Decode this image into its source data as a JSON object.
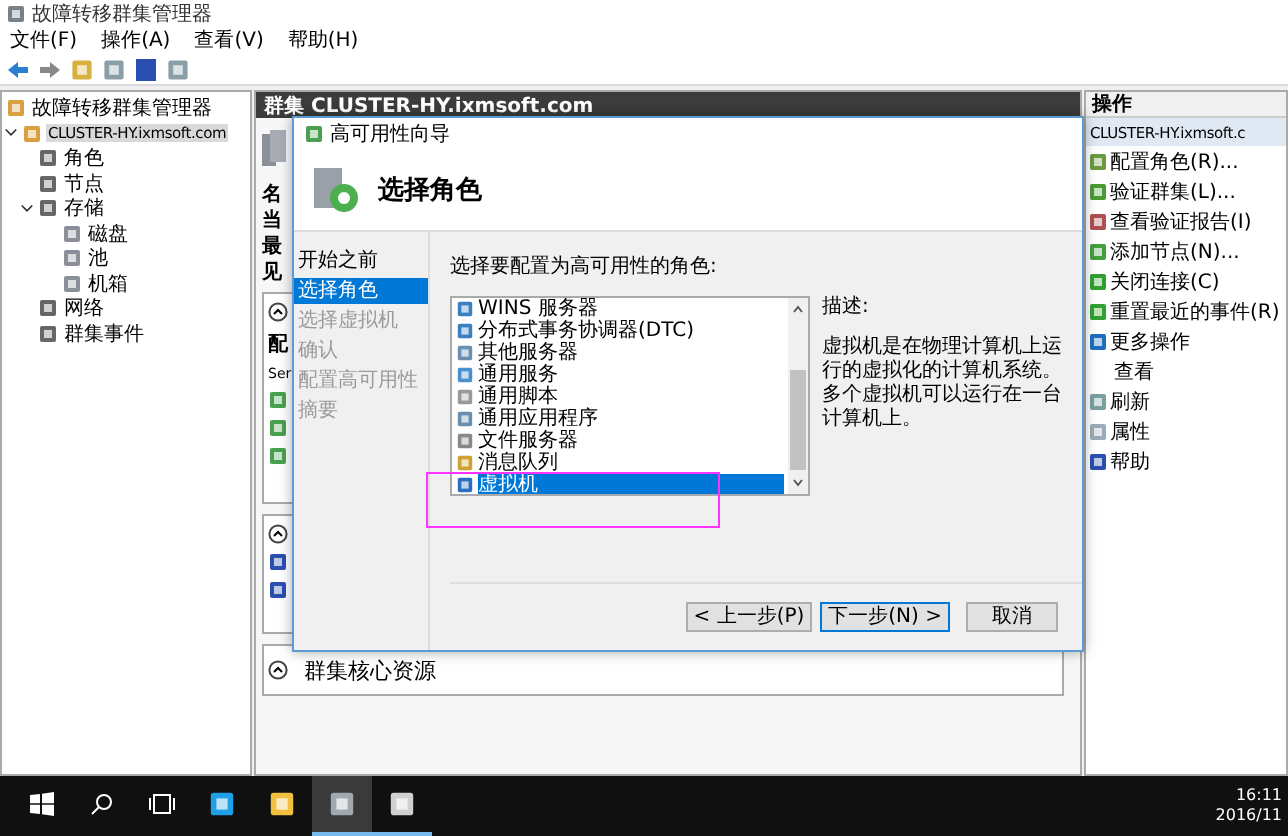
{
  "window": {
    "title": "故障转移群集管理器"
  },
  "menu": [
    "文件(F)",
    "操作(A)",
    "查看(V)",
    "帮助(H)"
  ],
  "tree": [
    {
      "label": "故障转移群集管理器",
      "selected": false,
      "children": [
        {
          "label": "CLUSTER-HY.ixmsoft.com",
          "selected": true,
          "expanded": true,
          "children": [
            {
              "label": "角色",
              "selected": false
            },
            {
              "label": "节点",
              "selected": false
            },
            {
              "label": "存储",
              "selected": false,
              "expanded": true,
              "children": [
                {
                  "label": "磁盘",
                  "selected": false
                },
                {
                  "label": "池",
                  "selected": false
                },
                {
                  "label": "机箱",
                  "selected": false
                }
              ]
            },
            {
              "label": "网络",
              "selected": false
            },
            {
              "label": "群集事件",
              "selected": false
            }
          ]
        }
      ]
    }
  ],
  "center": {
    "header": "群集 CLUSTER-HY.ixmsoft.com",
    "labels_cut": [
      "名",
      "当",
      "最",
      "见"
    ],
    "summary_cut": [
      "配",
      "Ser"
    ],
    "section": "群集核心资源"
  },
  "dialog": {
    "title": "高可用性向导",
    "heading": "选择角色",
    "steps": [
      {
        "label": "开始之前",
        "selected": false,
        "disabled": false
      },
      {
        "label": "选择角色",
        "selected": true,
        "disabled": false
      },
      {
        "label": "选择虚拟机",
        "selected": false,
        "disabled": true
      },
      {
        "label": "确认",
        "selected": false,
        "disabled": true
      },
      {
        "label": "配置高可用性",
        "selected": false,
        "disabled": true
      },
      {
        "label": "摘要",
        "selected": false,
        "disabled": true
      }
    ],
    "prompt": "选择要配置为高可用性的角色:",
    "roles": [
      {
        "label": "WINS 服务器",
        "selected": false
      },
      {
        "label": "分布式事务协调器(DTC)",
        "selected": false
      },
      {
        "label": "其他服务器",
        "selected": false
      },
      {
        "label": "通用服务",
        "selected": false
      },
      {
        "label": "通用脚本",
        "selected": false
      },
      {
        "label": "通用应用程序",
        "selected": false
      },
      {
        "label": "文件服务器",
        "selected": false
      },
      {
        "label": "消息队列",
        "selected": false
      },
      {
        "label": "虚拟机",
        "selected": true
      }
    ],
    "description_label": "描述:",
    "description": "虚拟机是在物理计算机上运行的虚拟化的计算机系统。多个虚拟机可以运行在一台计算机上。",
    "buttons": [
      {
        "label": "< 上一步(P)",
        "kind": "back"
      },
      {
        "label": "下一步(N) >",
        "kind": "default"
      },
      {
        "label": "取消",
        "kind": "normal"
      }
    ]
  },
  "actions": {
    "title": "操作",
    "group": "CLUSTER-HY.ixmsoft.c",
    "items": [
      {
        "label": "配置角色(R)...",
        "kind": "action"
      },
      {
        "label": "验证群集(L)...",
        "kind": "action"
      },
      {
        "label": "查看验证报告(I)",
        "kind": "action"
      },
      {
        "label": "添加节点(N)...",
        "kind": "action"
      },
      {
        "label": "关闭连接(C)",
        "kind": "action"
      },
      {
        "label": "重置最近的事件(R)",
        "kind": "action"
      },
      {
        "label": "更多操作",
        "kind": "action"
      },
      {
        "label": "查看",
        "kind": "submenu"
      },
      {
        "label": "刷新",
        "kind": "action"
      },
      {
        "label": "属性",
        "kind": "action"
      },
      {
        "label": "帮助",
        "kind": "action"
      }
    ]
  },
  "taskbar": {
    "apps": [
      {
        "kind": "browser",
        "running": false,
        "active": false
      },
      {
        "kind": "folder",
        "running": false,
        "active": false
      },
      {
        "kind": "cluster",
        "running": true,
        "active": true
      },
      {
        "kind": "server",
        "running": true,
        "active": false
      }
    ],
    "time": "16:11",
    "date": "2016/11"
  }
}
